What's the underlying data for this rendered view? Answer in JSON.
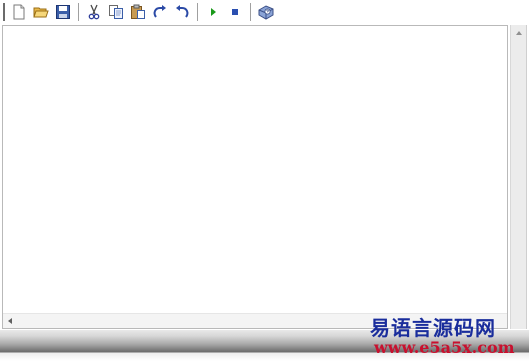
{
  "toolbar": {
    "buttons": [
      {
        "name": "new-file-button",
        "icon": "new-file-icon"
      },
      {
        "name": "open-file-button",
        "icon": "folder-open-icon"
      },
      {
        "name": "save-button",
        "icon": "save-icon"
      },
      {
        "name": "cut-button",
        "icon": "scissors-icon"
      },
      {
        "name": "copy-button",
        "icon": "copy-icon"
      },
      {
        "name": "paste-button",
        "icon": "paste-icon"
      },
      {
        "name": "redo-button",
        "icon": "redo-icon"
      },
      {
        "name": "undo-button",
        "icon": "undo-icon"
      },
      {
        "name": "run-button",
        "icon": "play-icon"
      },
      {
        "name": "stop-button",
        "icon": "stop-icon"
      },
      {
        "name": "help-button",
        "icon": "help-book-icon"
      }
    ]
  },
  "editor": {
    "content": ""
  },
  "watermark": {
    "title": "易语言源码网",
    "url": "www.e5a5x.com"
  },
  "colors": {
    "watermark_title": "#1a2d9c",
    "watermark_url": "#c8102e",
    "run_green": "#1a9a1a",
    "stop_blue": "#2a4fb0"
  }
}
